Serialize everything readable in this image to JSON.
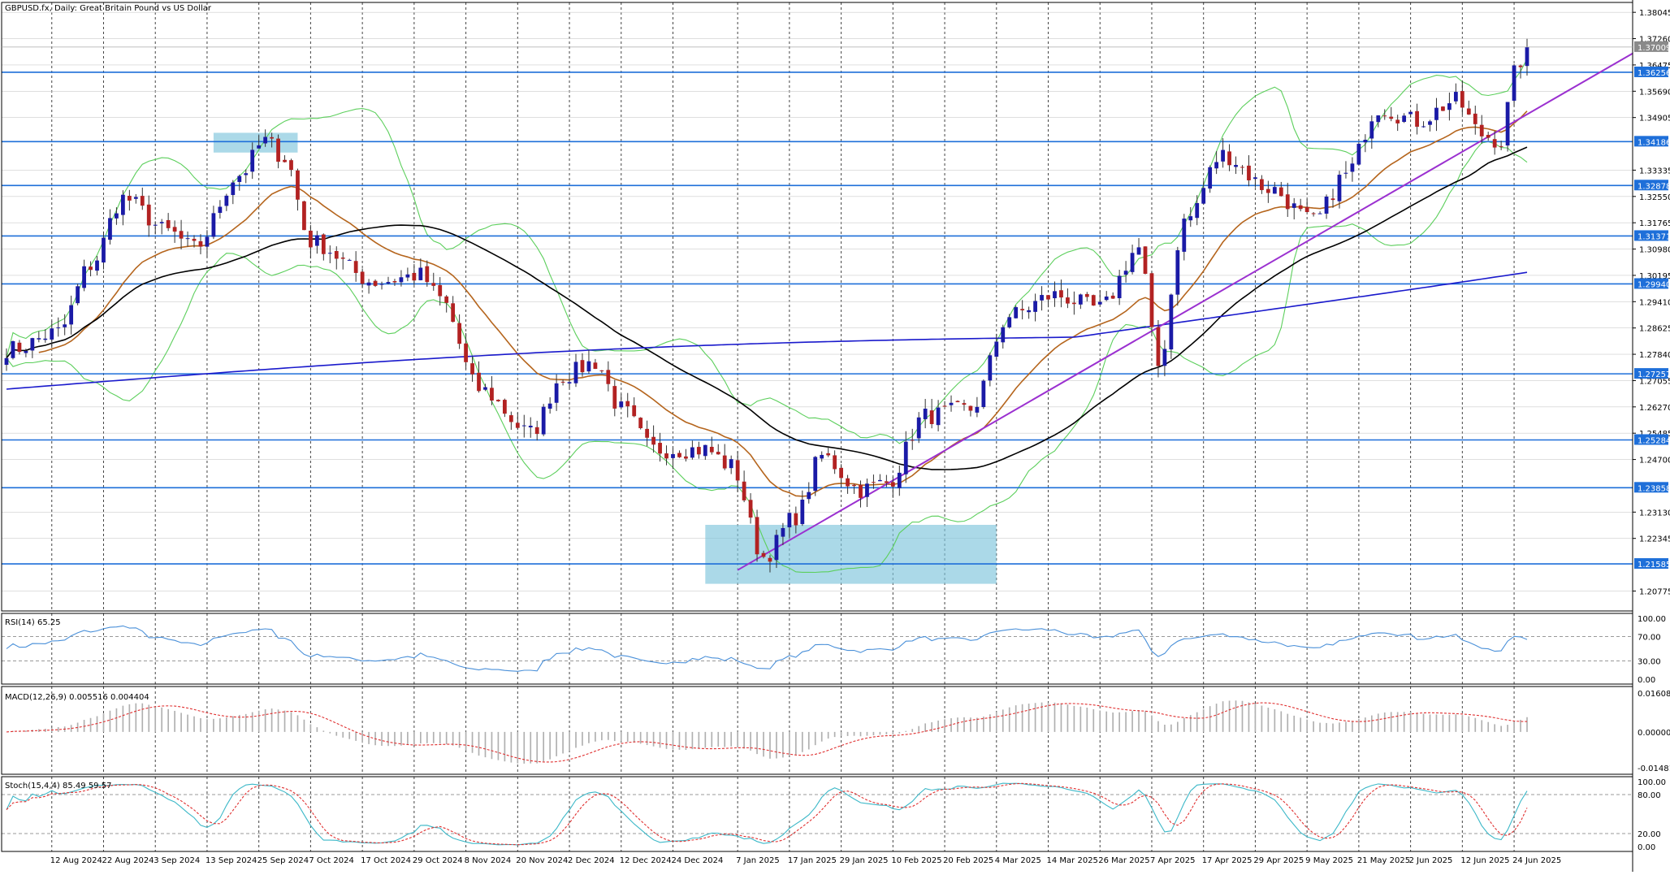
{
  "header": {
    "main_title": "GBPUSD.fx, Daily:  Great Britain Pound vs US Dollar",
    "rsi_title": "RSI(14) 65.25",
    "macd_title": "MACD(12,26,9) 0.005516 0.004404",
    "stoch_title": "Stoch(15,4,4) 85.49 59.57"
  },
  "colors": {
    "up_candle": "#1a1aa6",
    "down_candle": "#b22222",
    "hline": "#1e6fd9",
    "trendline": "#9b30d0",
    "bollinger": "#5ccf5c",
    "ma_short": "#b5651d",
    "ma_mid": "#000000",
    "ma_long": "#1a1acc",
    "zone_fill": "#7ec4dc",
    "rsi_line": "#4a90d9",
    "macd_hist": "#b0b0b0",
    "macd_signal": "#e03030",
    "stoch_main": "#3cb8c8",
    "stoch_signal": "#e03030",
    "price_tag_bg": "#1e6fd9",
    "current_tag_bg": "#8a8a8a"
  },
  "x_axis_labels": [
    "12 Aug 2024",
    "22 Aug 2024",
    "3 Sep 2024",
    "13 Sep 2024",
    "25 Sep 2024",
    "7 Oct 2024",
    "17 Oct 2024",
    "29 Oct 2024",
    "8 Nov 2024",
    "20 Nov 2024",
    "2 Dec 2024",
    "12 Dec 2024",
    "24 Dec 2024",
    "7 Jan 2025",
    "17 Jan 2025",
    "29 Jan 2025",
    "10 Feb 2025",
    "20 Feb 2025",
    "4 Mar 2025",
    "14 Mar 2025",
    "26 Mar 2025",
    "7 Apr 2025",
    "17 Apr 2025",
    "29 Apr 2025",
    "9 May 2025",
    "21 May 2025",
    "2 Jun 2025",
    "12 Jun 2025",
    "24 Jun 2025"
  ],
  "chart_data": {
    "type": "candlestick",
    "y_ticks": [
      "1.38045",
      "1.37260",
      "1.36475",
      "1.35690",
      "1.34905",
      "1.33335",
      "1.32550",
      "1.31765",
      "1.30980",
      "1.30195",
      "1.29410",
      "1.28625",
      "1.27840",
      "1.27055",
      "1.26270",
      "1.25485",
      "1.24700",
      "1.23130",
      "1.22345",
      "1.20775"
    ],
    "ylim": [
      1.2018,
      1.3834
    ],
    "current_price": "1.37009",
    "horizontal_levels": [
      "1.36256",
      "1.34186",
      "1.32878",
      "1.31371",
      "1.29940",
      "1.27257",
      "1.25284",
      "1.23858",
      "1.21585"
    ],
    "trendline": {
      "from": {
        "date": "7 Jan 2025",
        "value": 1.214
      },
      "to": {
        "date": "26 Jun 2025",
        "value": 1.35
      }
    },
    "zones": [
      {
        "from": "16 Sep 2024",
        "to": "3 Oct 2024",
        "low": 1.3386,
        "high": 1.3445
      },
      {
        "from": "31 Dec 2024",
        "to": "4 Mar 2025",
        "low": 1.2099,
        "high": 1.2275
      }
    ],
    "ohlc_knots": [
      {
        "d": "2 Aug 2024",
        "c": 1.28
      },
      {
        "d": "13 Aug 2024",
        "c": 1.285
      },
      {
        "d": "20 Aug 2024",
        "c": 1.305
      },
      {
        "d": "27 Aug 2024",
        "c": 1.325
      },
      {
        "d": "5 Sep 2024",
        "c": 1.315
      },
      {
        "d": "11 Sep 2024",
        "c": 1.31
      },
      {
        "d": "20 Sep 2024",
        "c": 1.332
      },
      {
        "d": "26 Sep 2024",
        "c": 1.342
      },
      {
        "d": "1 Oct 2024",
        "c": 1.337
      },
      {
        "d": "7 Oct 2024",
        "c": 1.312
      },
      {
        "d": "21 Oct 2024",
        "c": 1.3
      },
      {
        "d": "30 Oct 2024",
        "c": 1.302
      },
      {
        "d": "4 Nov 2024",
        "c": 1.295
      },
      {
        "d": "12 Nov 2024",
        "c": 1.268
      },
      {
        "d": "22 Nov 2024",
        "c": 1.255
      },
      {
        "d": "29 Nov 2024",
        "c": 1.272
      },
      {
        "d": "6 Dec 2024",
        "c": 1.276
      },
      {
        "d": "12 Dec 2024",
        "c": 1.262
      },
      {
        "d": "19 Dec 2024",
        "c": 1.25
      },
      {
        "d": "31 Dec 2024",
        "c": 1.25
      },
      {
        "d": "6 Jan 2025",
        "c": 1.245
      },
      {
        "d": "13 Jan 2025",
        "c": 1.218
      },
      {
        "d": "20 Jan 2025",
        "c": 1.23
      },
      {
        "d": "24 Jan 2025",
        "c": 1.248
      },
      {
        "d": "3 Feb 2025",
        "c": 1.238
      },
      {
        "d": "7 Feb 2025",
        "c": 1.24
      },
      {
        "d": "17 Feb 2025",
        "c": 1.26
      },
      {
        "d": "26 Feb 2025",
        "c": 1.262
      },
      {
        "d": "6 Mar 2025",
        "c": 1.29
      },
      {
        "d": "17 Mar 2025",
        "c": 1.296
      },
      {
        "d": "26 Mar 2025",
        "c": 1.292
      },
      {
        "d": "3 Apr 2025",
        "c": 1.31
      },
      {
        "d": "8 Apr 2025",
        "c": 1.275
      },
      {
        "d": "14 Apr 2025",
        "c": 1.318
      },
      {
        "d": "22 Apr 2025",
        "c": 1.338
      },
      {
        "d": "1 May 2025",
        "c": 1.328
      },
      {
        "d": "12 May 2025",
        "c": 1.318
      },
      {
        "d": "19 May 2025",
        "c": 1.332
      },
      {
        "d": "26 May 2025",
        "c": 1.352
      },
      {
        "d": "3 Jun 2025",
        "c": 1.348
      },
      {
        "d": "11 Jun 2025",
        "c": 1.354
      },
      {
        "d": "17 Jun 2025",
        "c": 1.344
      },
      {
        "d": "20 Jun 2025",
        "c": 1.342
      },
      {
        "d": "24 Jun 2025",
        "c": 1.362
      },
      {
        "d": "26 Jun 2025",
        "c": 1.37
      }
    ],
    "indicators": {
      "rsi": {
        "value": 65.25,
        "levels": [
          "100.00",
          "70.00",
          "30.00",
          "0.00"
        ]
      },
      "macd": {
        "main": 0.005516,
        "signal": 0.004404,
        "levels": [
          "0.016085",
          "0.000000",
          "-0.014818"
        ]
      },
      "stoch": {
        "k": 85.49,
        "d": 59.57,
        "levels": [
          "100.00",
          "80.00",
          "20.00",
          "0.00"
        ]
      }
    }
  }
}
